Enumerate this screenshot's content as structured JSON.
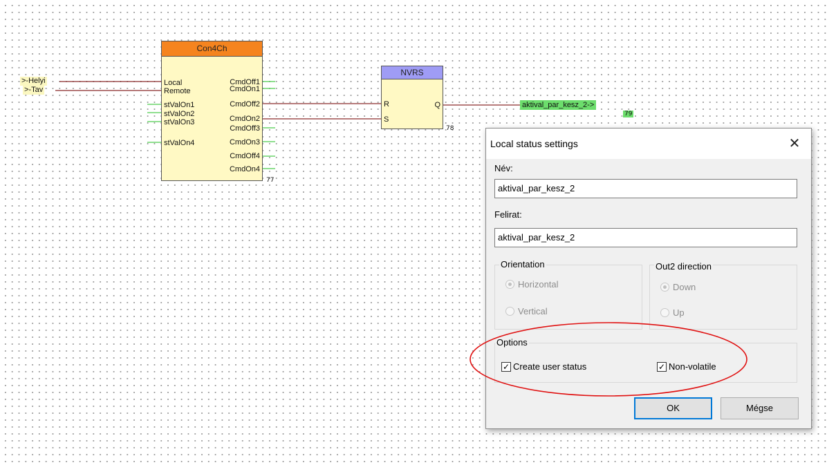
{
  "diagram": {
    "inputs": [
      {
        "label": ">-Helyi"
      },
      {
        "label": ">-Tav"
      }
    ],
    "con4ch": {
      "title": "Con4Ch",
      "title_color": "#f5841f",
      "inputs": [
        "Local",
        "Remote",
        "stValOn1",
        "stValOn2",
        "stValOn3",
        "stValOn4"
      ],
      "outputs": [
        "CmdOff1",
        "CmdOn1",
        "CmdOff2",
        "CmdOn2",
        "CmdOff3",
        "CmdOn3",
        "CmdOff4",
        "CmdOn4"
      ],
      "number": "77"
    },
    "nvrs": {
      "title": "NVRS",
      "title_color": "#9f9cf5",
      "inputs": [
        "R",
        "S"
      ],
      "outputs": [
        "Q"
      ],
      "number": "78"
    },
    "output_tag": {
      "label": "aktival_par_kesz_2->",
      "number": "79",
      "color": "#6cdd6c"
    }
  },
  "dialog": {
    "title": "Local status settings",
    "close_icon": "close-icon",
    "name_label": "Név:",
    "name_value": "aktival_par_kesz_2",
    "caption_label": "Felirat:",
    "caption_value": "aktival_par_kesz_2",
    "orientation": {
      "legend": "Orientation",
      "options": [
        "Horizontal",
        "Vertical"
      ],
      "selected": "Horizontal"
    },
    "out2_direction": {
      "legend": "Out2 direction",
      "options": [
        "Down",
        "Up"
      ],
      "selected": "Down"
    },
    "options": {
      "legend": "Options",
      "create_user_status": {
        "label": "Create user status",
        "checked": true
      },
      "non_volatile": {
        "label": "Non-volatile",
        "checked": true
      }
    },
    "ok_label": "OK",
    "cancel_label": "Mégse"
  },
  "annotation_color": "#e01010"
}
